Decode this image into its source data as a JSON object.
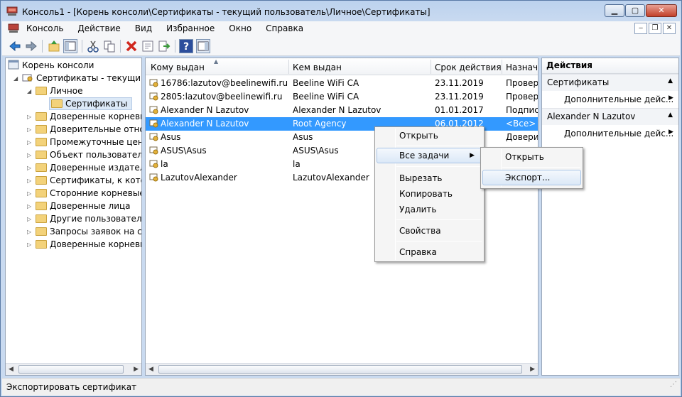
{
  "window": {
    "title": "Консоль1 - [Корень консоли\\Сертификаты - текущий пользователь\\Личное\\Сертификаты]"
  },
  "menu": [
    "Консоль",
    "Действие",
    "Вид",
    "Избранное",
    "Окно",
    "Справка"
  ],
  "tree": {
    "root": "Корень консоли",
    "store": "Сертификаты - текущий п",
    "personal": "Личное",
    "certs": "Сертификаты",
    "others": [
      "Доверенные корневые",
      "Доверительные отнош",
      "Промежуточные центр",
      "Объект пользователя А",
      "Доверенные издатели",
      "Сертификаты, к которь",
      "Сторонние корневые ц",
      "Доверенные лица",
      "Другие пользователи",
      "Запросы заявок на сер",
      "Доверенные корневые"
    ]
  },
  "list": {
    "columns": [
      "Кому выдан",
      "Кем выдан",
      "Срок действия",
      "Назначе"
    ],
    "rows": [
      {
        "to": "16786:lazutov@beelinewifi.ru",
        "by": "Beeline WiFi CA",
        "exp": "23.11.2019",
        "purpose": "Провер"
      },
      {
        "to": "2805:lazutov@beelinewifi.ru",
        "by": "Beeline WiFi CA",
        "exp": "23.11.2019",
        "purpose": "Провер"
      },
      {
        "to": "Alexander N Lazutov",
        "by": "Alexander N Lazutov",
        "exp": "01.01.2017",
        "purpose": "Подпис"
      },
      {
        "to": "Alexander N Lazutov",
        "by": "Root Agency",
        "exp": "06.01.2012",
        "purpose": "<Все>"
      },
      {
        "to": "Asus",
        "by": "Asus",
        "exp": "",
        "purpose": "Довери"
      },
      {
        "to": "ASUS\\Asus",
        "by": "ASUS\\Asus",
        "exp": "",
        "purpose": ""
      },
      {
        "to": "la",
        "by": "la",
        "exp": "",
        "purpose": ""
      },
      {
        "to": "LazutovAlexander",
        "by": "LazutovAlexander",
        "exp": "",
        "purpose": ""
      }
    ]
  },
  "actions": {
    "header": "Действия",
    "section1": "Сертификаты",
    "more1": "Дополнительные дейс...",
    "section2": "Alexander N Lazutov",
    "more2": "Дополнительные дейс..."
  },
  "context_menu": {
    "open": "Открыть",
    "all_tasks": "Все задачи",
    "cut": "Вырезать",
    "copy": "Копировать",
    "delete": "Удалить",
    "properties": "Свойства",
    "help": "Справка"
  },
  "submenu": {
    "open": "Открыть",
    "export": "Экспорт..."
  },
  "status": "Экспортировать сертификат",
  "colors": {
    "selection": "#3399ff",
    "accent": "#c2402a"
  }
}
